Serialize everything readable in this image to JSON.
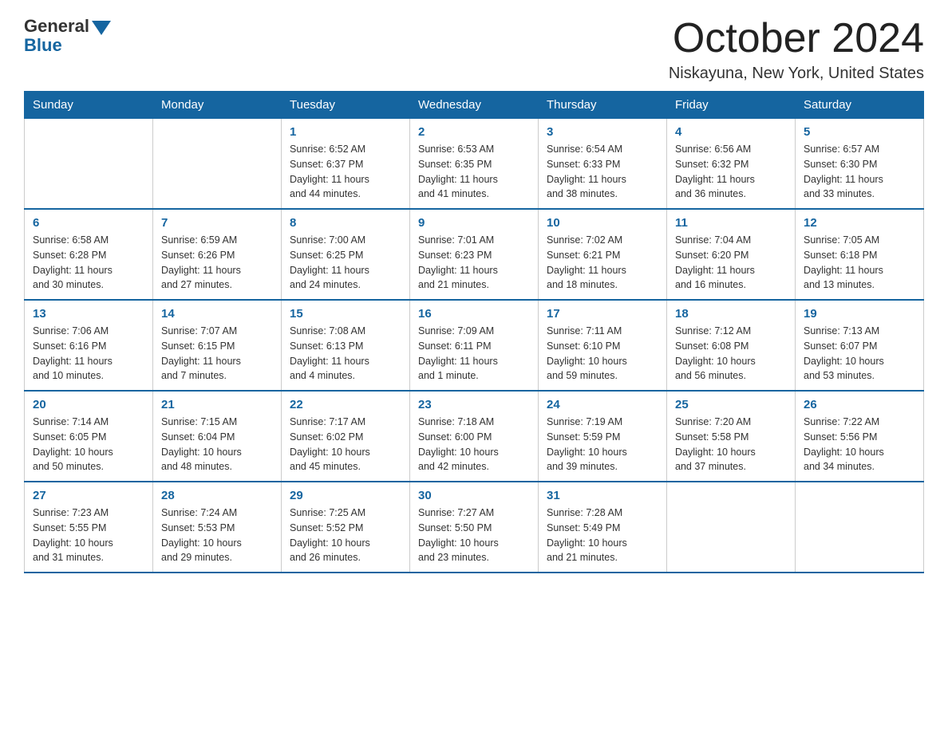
{
  "header": {
    "logo_general": "General",
    "logo_blue": "Blue",
    "month_title": "October 2024",
    "location": "Niskayuna, New York, United States"
  },
  "weekdays": [
    "Sunday",
    "Monday",
    "Tuesday",
    "Wednesday",
    "Thursday",
    "Friday",
    "Saturday"
  ],
  "weeks": [
    [
      {
        "day": "",
        "info": ""
      },
      {
        "day": "",
        "info": ""
      },
      {
        "day": "1",
        "info": "Sunrise: 6:52 AM\nSunset: 6:37 PM\nDaylight: 11 hours\nand 44 minutes."
      },
      {
        "day": "2",
        "info": "Sunrise: 6:53 AM\nSunset: 6:35 PM\nDaylight: 11 hours\nand 41 minutes."
      },
      {
        "day": "3",
        "info": "Sunrise: 6:54 AM\nSunset: 6:33 PM\nDaylight: 11 hours\nand 38 minutes."
      },
      {
        "day": "4",
        "info": "Sunrise: 6:56 AM\nSunset: 6:32 PM\nDaylight: 11 hours\nand 36 minutes."
      },
      {
        "day": "5",
        "info": "Sunrise: 6:57 AM\nSunset: 6:30 PM\nDaylight: 11 hours\nand 33 minutes."
      }
    ],
    [
      {
        "day": "6",
        "info": "Sunrise: 6:58 AM\nSunset: 6:28 PM\nDaylight: 11 hours\nand 30 minutes."
      },
      {
        "day": "7",
        "info": "Sunrise: 6:59 AM\nSunset: 6:26 PM\nDaylight: 11 hours\nand 27 minutes."
      },
      {
        "day": "8",
        "info": "Sunrise: 7:00 AM\nSunset: 6:25 PM\nDaylight: 11 hours\nand 24 minutes."
      },
      {
        "day": "9",
        "info": "Sunrise: 7:01 AM\nSunset: 6:23 PM\nDaylight: 11 hours\nand 21 minutes."
      },
      {
        "day": "10",
        "info": "Sunrise: 7:02 AM\nSunset: 6:21 PM\nDaylight: 11 hours\nand 18 minutes."
      },
      {
        "day": "11",
        "info": "Sunrise: 7:04 AM\nSunset: 6:20 PM\nDaylight: 11 hours\nand 16 minutes."
      },
      {
        "day": "12",
        "info": "Sunrise: 7:05 AM\nSunset: 6:18 PM\nDaylight: 11 hours\nand 13 minutes."
      }
    ],
    [
      {
        "day": "13",
        "info": "Sunrise: 7:06 AM\nSunset: 6:16 PM\nDaylight: 11 hours\nand 10 minutes."
      },
      {
        "day": "14",
        "info": "Sunrise: 7:07 AM\nSunset: 6:15 PM\nDaylight: 11 hours\nand 7 minutes."
      },
      {
        "day": "15",
        "info": "Sunrise: 7:08 AM\nSunset: 6:13 PM\nDaylight: 11 hours\nand 4 minutes."
      },
      {
        "day": "16",
        "info": "Sunrise: 7:09 AM\nSunset: 6:11 PM\nDaylight: 11 hours\nand 1 minute."
      },
      {
        "day": "17",
        "info": "Sunrise: 7:11 AM\nSunset: 6:10 PM\nDaylight: 10 hours\nand 59 minutes."
      },
      {
        "day": "18",
        "info": "Sunrise: 7:12 AM\nSunset: 6:08 PM\nDaylight: 10 hours\nand 56 minutes."
      },
      {
        "day": "19",
        "info": "Sunrise: 7:13 AM\nSunset: 6:07 PM\nDaylight: 10 hours\nand 53 minutes."
      }
    ],
    [
      {
        "day": "20",
        "info": "Sunrise: 7:14 AM\nSunset: 6:05 PM\nDaylight: 10 hours\nand 50 minutes."
      },
      {
        "day": "21",
        "info": "Sunrise: 7:15 AM\nSunset: 6:04 PM\nDaylight: 10 hours\nand 48 minutes."
      },
      {
        "day": "22",
        "info": "Sunrise: 7:17 AM\nSunset: 6:02 PM\nDaylight: 10 hours\nand 45 minutes."
      },
      {
        "day": "23",
        "info": "Sunrise: 7:18 AM\nSunset: 6:00 PM\nDaylight: 10 hours\nand 42 minutes."
      },
      {
        "day": "24",
        "info": "Sunrise: 7:19 AM\nSunset: 5:59 PM\nDaylight: 10 hours\nand 39 minutes."
      },
      {
        "day": "25",
        "info": "Sunrise: 7:20 AM\nSunset: 5:58 PM\nDaylight: 10 hours\nand 37 minutes."
      },
      {
        "day": "26",
        "info": "Sunrise: 7:22 AM\nSunset: 5:56 PM\nDaylight: 10 hours\nand 34 minutes."
      }
    ],
    [
      {
        "day": "27",
        "info": "Sunrise: 7:23 AM\nSunset: 5:55 PM\nDaylight: 10 hours\nand 31 minutes."
      },
      {
        "day": "28",
        "info": "Sunrise: 7:24 AM\nSunset: 5:53 PM\nDaylight: 10 hours\nand 29 minutes."
      },
      {
        "day": "29",
        "info": "Sunrise: 7:25 AM\nSunset: 5:52 PM\nDaylight: 10 hours\nand 26 minutes."
      },
      {
        "day": "30",
        "info": "Sunrise: 7:27 AM\nSunset: 5:50 PM\nDaylight: 10 hours\nand 23 minutes."
      },
      {
        "day": "31",
        "info": "Sunrise: 7:28 AM\nSunset: 5:49 PM\nDaylight: 10 hours\nand 21 minutes."
      },
      {
        "day": "",
        "info": ""
      },
      {
        "day": "",
        "info": ""
      }
    ]
  ]
}
